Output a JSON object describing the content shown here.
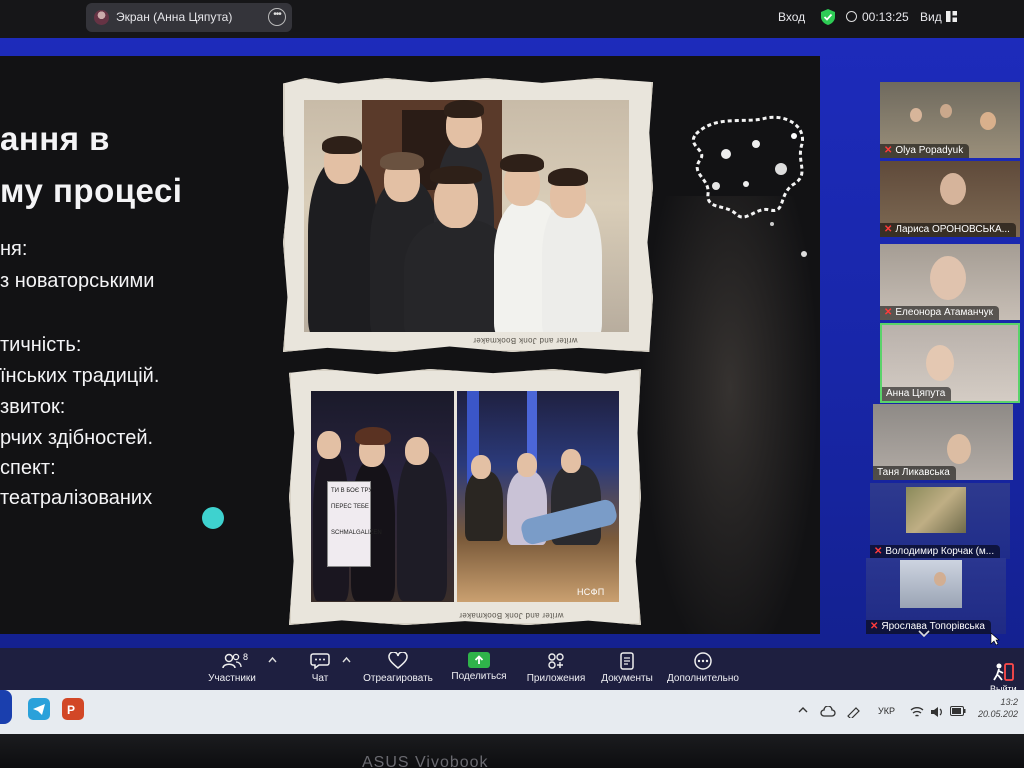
{
  "top_bar": {
    "share_tab_label": "Экран (Анна Цяпута)",
    "login_label": "Вход",
    "timer": "00:13:25",
    "view_label": "Вид"
  },
  "slide": {
    "title_lines": [
      "ання в",
      "му процесі"
    ],
    "text_lines": [
      "ня:",
      "з новаторськими",
      "тичність:",
      "їнських традицій.",
      "звиток:",
      "рчих здібностей.",
      "спект:",
      "театралізованих"
    ],
    "photo_caption": "writer and Jonk Bookmaker",
    "sign_lines": [
      "ТИ В БОЄ ТРУ",
      "ПЕРЕС ТЕБЕ",
      "SCHMALGALIZEN"
    ],
    "photo_watermark": "НСФП"
  },
  "participants": [
    {
      "name": "Olya Popadyuk",
      "muted": true
    },
    {
      "name": "Лариса ОРОНОВСЬКА...",
      "muted": true
    },
    {
      "name": "Елеонора Атаманчук",
      "muted": true
    },
    {
      "name": "Анна Цяпута",
      "muted": false
    },
    {
      "name": "Таня Ликавська",
      "muted": false
    },
    {
      "name": "Володимир Корчак (м...",
      "muted": true
    },
    {
      "name": "Ярослава Топорівська",
      "muted": true
    }
  ],
  "muted_icon": "muted-mic-icon",
  "toolbar": {
    "participants_label": "Участники",
    "participants_count": "8",
    "chat_label": "Чат",
    "react_label": "Отреагировать",
    "share_label": "Поделиться",
    "apps_label": "Приложения",
    "docs_label": "Документы",
    "more_label": "Дополнительно",
    "leave_label": "Выйти"
  },
  "taskbar": {
    "language": "УКР",
    "time": "13:2",
    "date": "20.05.202"
  },
  "bezel_brand": "ASUS Vivobook",
  "colors": {
    "zoom_blue": "#1d2bbb",
    "share_green": "#2fb34a",
    "active_speaker": "#5ad36a",
    "accent_dot": "#3ed2cf",
    "muted_red": "#ff3b3b"
  }
}
